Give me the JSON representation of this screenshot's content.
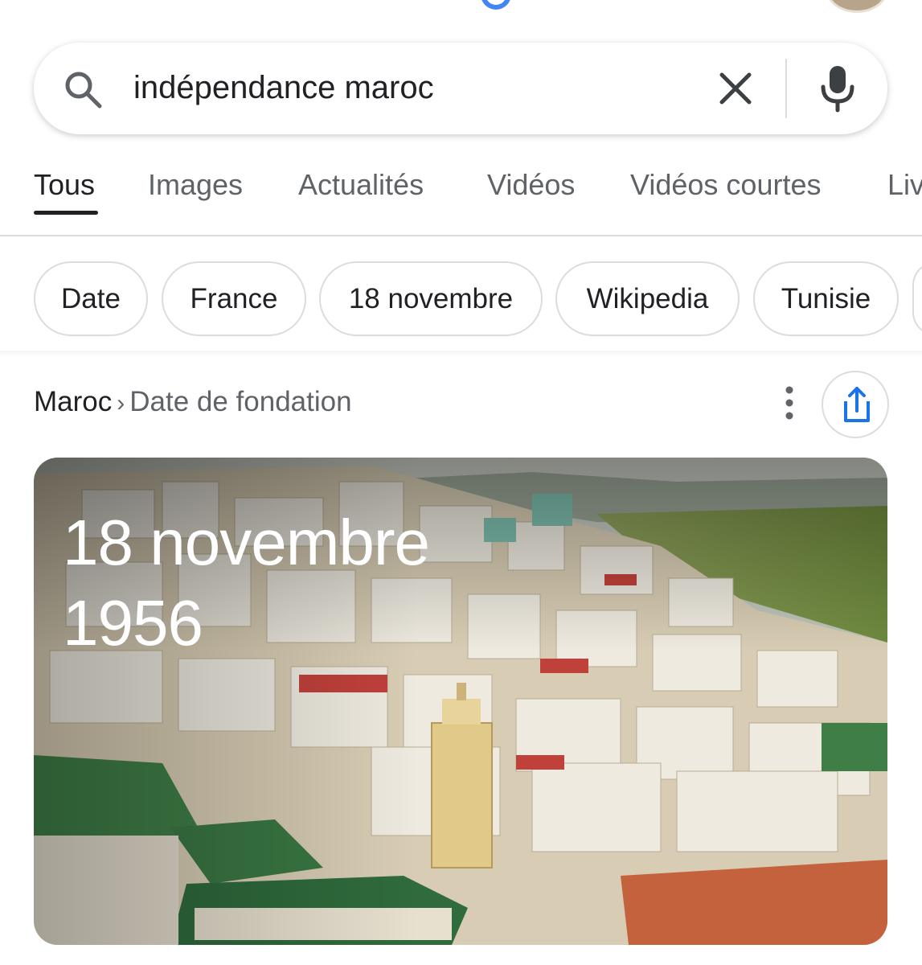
{
  "search": {
    "query": "indépendance maroc"
  },
  "tabs": [
    {
      "label": "Tous",
      "active": true
    },
    {
      "label": "Images",
      "active": false
    },
    {
      "label": "Actualités",
      "active": false
    },
    {
      "label": "Vidéos",
      "active": false
    },
    {
      "label": "Vidéos courtes",
      "active": false
    },
    {
      "label": "Liv",
      "active": false
    }
  ],
  "chips": [
    "Date",
    "France",
    "18 novembre",
    "Wikipedia",
    "Tunisie"
  ],
  "result": {
    "breadcrumb": {
      "entity": "Maroc",
      "separator": "›",
      "attribute": "Date de fondation"
    },
    "answer_line1": "18 novembre",
    "answer_line2": "1956"
  },
  "colors": {
    "accent_blue": "#1a73e8",
    "text_primary": "#202124",
    "text_secondary": "#5f6368",
    "border": "#dadce0"
  },
  "icons": {
    "search": "search-icon",
    "clear": "close-icon",
    "mic": "microphone-icon",
    "more": "more-vert-icon",
    "share": "share-icon"
  }
}
